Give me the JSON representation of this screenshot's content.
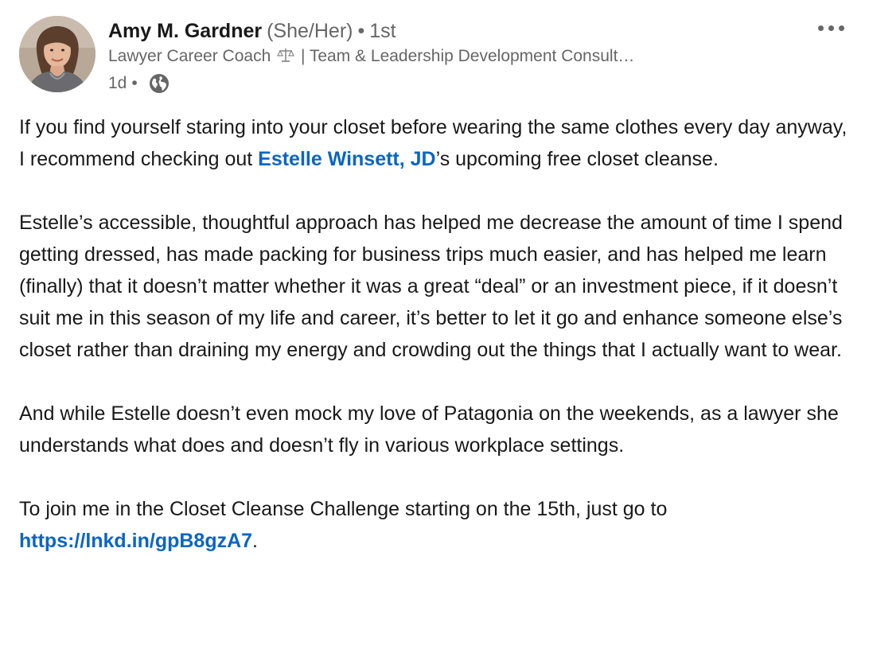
{
  "author": {
    "name": "Amy M. Gardner",
    "pronouns": "(She/Her)",
    "separator": "•",
    "connection_degree": "1st",
    "headline_start": "Lawyer Career Coach",
    "headline_end": "| Team & Leadership Development Consult…",
    "avatar_icon": "avatar-photo"
  },
  "meta": {
    "time_ago": "1d",
    "separator": "•",
    "visibility_icon": "globe-icon"
  },
  "menu": {
    "icon": "more-options-icon"
  },
  "post": {
    "p1_before": "If you find yourself staring into your closet before wearing the same clothes every day anyway, I recommend checking out ",
    "p1_mention": "Estelle Winsett, JD",
    "p1_after": "’s upcoming free closet cleanse.",
    "p2": "Estelle’s accessible, thoughtful approach has helped me decrease the amount of time I spend getting dressed, has made packing for business trips much easier, and has helped me learn (finally) that it doesn’t matter whether it was a great “deal” or an investment piece, if it doesn’t suit me in this season of my life and career, it’s better to let it go and enhance someone else’s closet rather than draining my energy and crowding out the things that I actually want to wear.",
    "p3": "And while Estelle doesn’t even mock my love of Patagonia on the weekends, as a lawyer she understands what does and doesn’t fly in various workplace settings.",
    "p4_before": "To join me in the Closet Cleanse Challenge starting on the 15th, just go to ",
    "p4_link": "https://lnkd.in/gpB8gzA7",
    "p4_after": "."
  },
  "colors": {
    "link": "#0a66c2",
    "text": "#191919",
    "secondary": "#666666"
  }
}
